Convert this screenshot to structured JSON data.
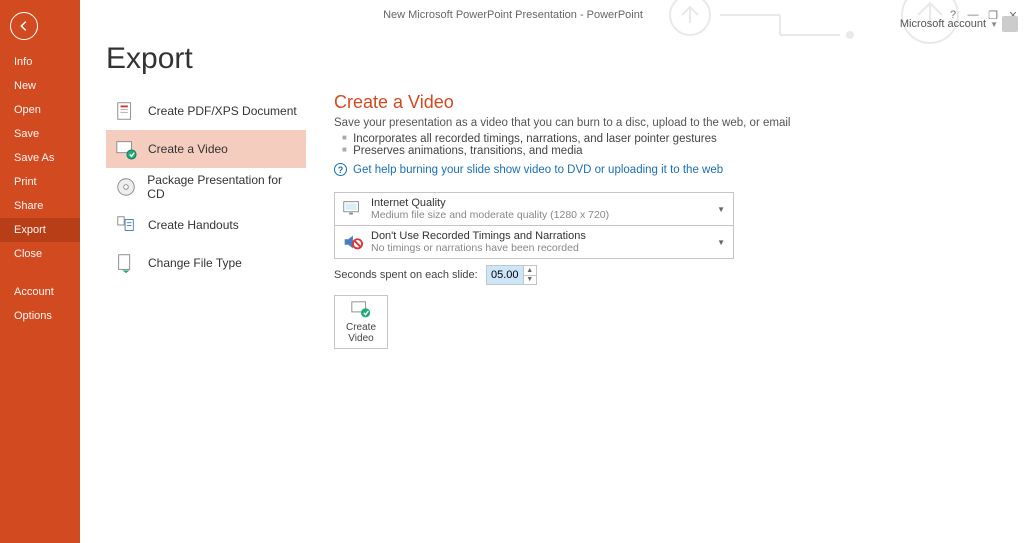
{
  "window": {
    "title": "New Microsoft PowerPoint Presentation - PowerPoint",
    "account_label": "Microsoft account"
  },
  "sidebar": {
    "items": [
      {
        "label": "Info"
      },
      {
        "label": "New"
      },
      {
        "label": "Open"
      },
      {
        "label": "Save"
      },
      {
        "label": "Save As"
      },
      {
        "label": "Print"
      },
      {
        "label": "Share"
      },
      {
        "label": "Export",
        "selected": true
      },
      {
        "label": "Close"
      }
    ],
    "footer_items": [
      {
        "label": "Account"
      },
      {
        "label": "Options"
      }
    ]
  },
  "page": {
    "title": "Export"
  },
  "export_list": [
    {
      "label": "Create PDF/XPS Document",
      "icon": "pdf"
    },
    {
      "label": "Create a Video",
      "icon": "video",
      "selected": true
    },
    {
      "label": "Package Presentation for CD",
      "icon": "cd"
    },
    {
      "label": "Create Handouts",
      "icon": "handouts"
    },
    {
      "label": "Change File Type",
      "icon": "filetype"
    }
  ],
  "detail": {
    "heading": "Create a Video",
    "description": "Save your presentation as a video that you can burn to a disc, upload to the web, or email",
    "bullets": [
      "Incorporates all recorded timings, narrations, and laser pointer gestures",
      "Preserves animations, transitions, and media"
    ],
    "help_link": "Get help burning your slide show video to DVD or uploading it to the web",
    "quality": {
      "title": "Internet Quality",
      "sub": "Medium file size and moderate quality (1280 x 720)"
    },
    "timings": {
      "title": "Don't Use Recorded Timings and Narrations",
      "sub": "No timings or narrations have been recorded"
    },
    "seconds_label": "Seconds spent on each slide:",
    "seconds_value": "05.00",
    "create_button_line1": "Create",
    "create_button_line2": "Video"
  }
}
